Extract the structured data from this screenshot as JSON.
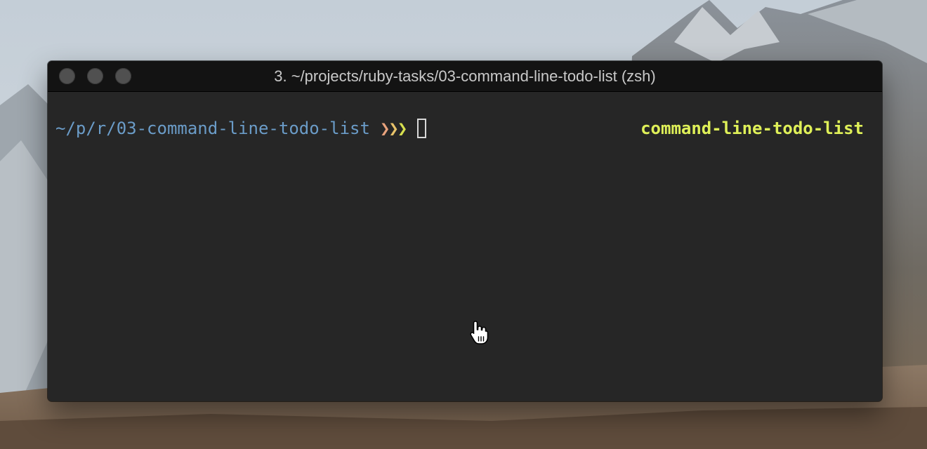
{
  "window": {
    "title": "3. ~/projects/ruby-tasks/03-command-line-todo-list (zsh)",
    "controls": [
      "close",
      "minimize",
      "zoom"
    ]
  },
  "terminal": {
    "cwd": "~/p/r/03-command-line-todo-list",
    "prompt_arrows": [
      "❯",
      "❯",
      "❯"
    ],
    "right_prompt": "command-line-todo-list",
    "colors": {
      "background": "#262626",
      "titlebar": "#131313",
      "cwd": "#6b9cc8",
      "arrow_1": "#e8a27c",
      "arrow_2": "#e8c36a",
      "arrow_3": "#d7e04f",
      "right_prompt": "#dff058"
    }
  },
  "pointer": {
    "icon": "hand-pointer-icon"
  }
}
